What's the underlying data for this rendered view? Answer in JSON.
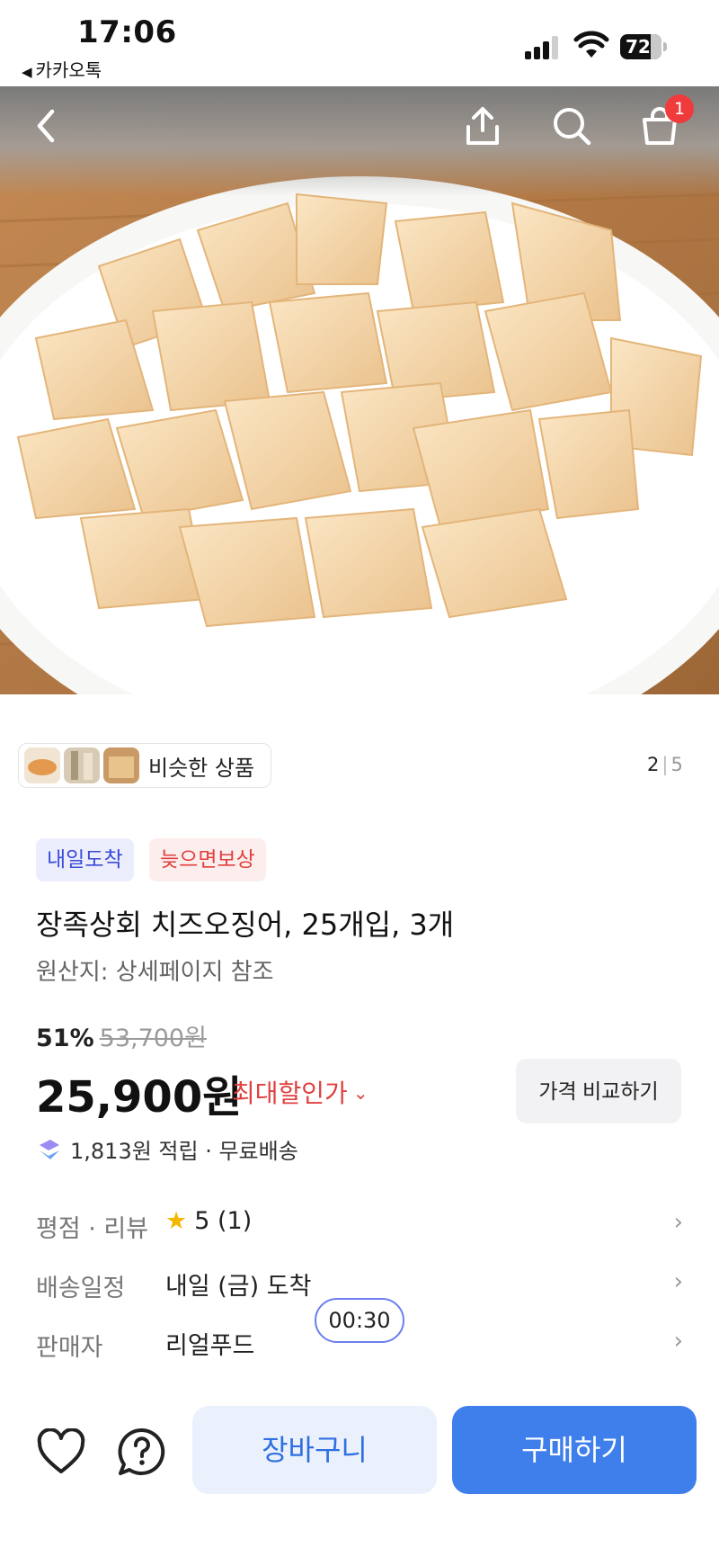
{
  "status_bar": {
    "time": "17:06",
    "back_app": "카카오톡",
    "battery": "72"
  },
  "nav": {
    "cart_count": "1"
  },
  "similar": {
    "label": "비슷한 상품"
  },
  "pager": {
    "current": "2",
    "separator": "|",
    "total": "5"
  },
  "badges": {
    "arrive": "내일도착",
    "late": "늦으면보상"
  },
  "product": {
    "title": "장족상회 치즈오징어, 25개입, 3개",
    "origin": "원산지: 상세페이지 참조",
    "discount_rate": "51%",
    "original_price": "53,700원",
    "price": "25,900원",
    "max_discount": "최대할인가",
    "compare_button": "가격 비교하기",
    "points": "1,813원 적립 · 무료배송"
  },
  "info": {
    "rating_key": "평점 · 리뷰",
    "rating_val": "5 (1)",
    "delivery_key": "배송일정",
    "delivery_val": "내일 (금) 도착",
    "seller_key": "판매자",
    "seller_val": "리얼푸드"
  },
  "timer": "00:30",
  "bottom": {
    "cart_button": "장바구니",
    "buy_button": "구매하기"
  },
  "colors": {
    "accent": "#3f7fec",
    "discount_red": "#e0403e",
    "arrive_badge": "#3a4bd6"
  }
}
